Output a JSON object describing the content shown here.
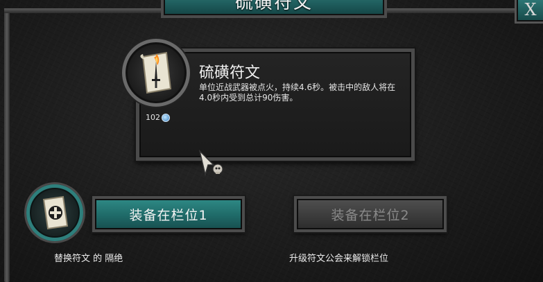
{
  "header": {
    "title": "硫磺符文",
    "close_label": "X"
  },
  "rune_info": {
    "name": "硫磺符文",
    "description": "单位近战武器被点火，持续4.6秒。被击中的敌人将在4.0秒内受到总计90伤害。",
    "count": "102",
    "icon": "burning-dagger-scroll-icon",
    "count_icon": "blue-potion-icon"
  },
  "slots": {
    "slot1_label": "装备在栏位1",
    "slot2_label": "装备在栏位2",
    "slot1_icon": "cross-rune-scroll-icon",
    "slot2_enabled": false
  },
  "captions": {
    "left": "替换符文 的 隔绝",
    "right": "升级符文公会来解锁栏位"
  },
  "colors": {
    "accent_teal": "#2f8a86",
    "disabled_gray": "#505050",
    "background": "#1c1c1c"
  }
}
